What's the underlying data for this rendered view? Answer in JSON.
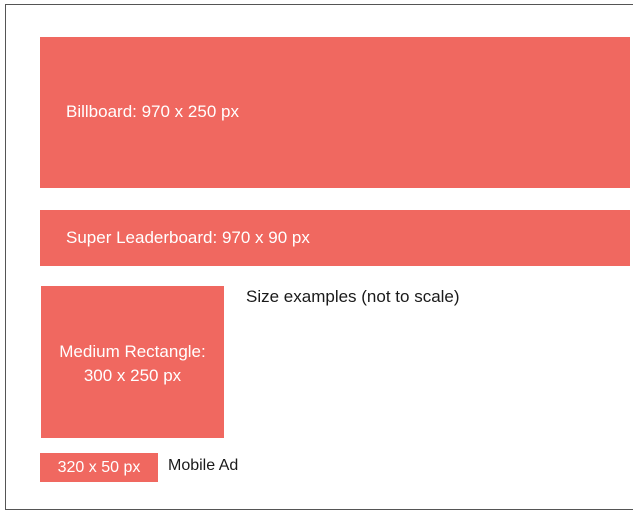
{
  "ads": {
    "billboard": "Billboard: 970 x 250 px",
    "super_leaderboard": "Super Leaderboard: 970 x 90 px",
    "medium_rectangle_line1": "Medium Rectangle:",
    "medium_rectangle_line2": "300 x 250 px",
    "mobile_size": "320 x 50 px",
    "mobile_label": "Mobile Ad"
  },
  "caption": "Size examples (not to scale)",
  "colors": {
    "ad_fill": "#f06860",
    "ad_text": "#ffffff",
    "label_text": "#1a1a1a",
    "frame_border": "#555555"
  }
}
